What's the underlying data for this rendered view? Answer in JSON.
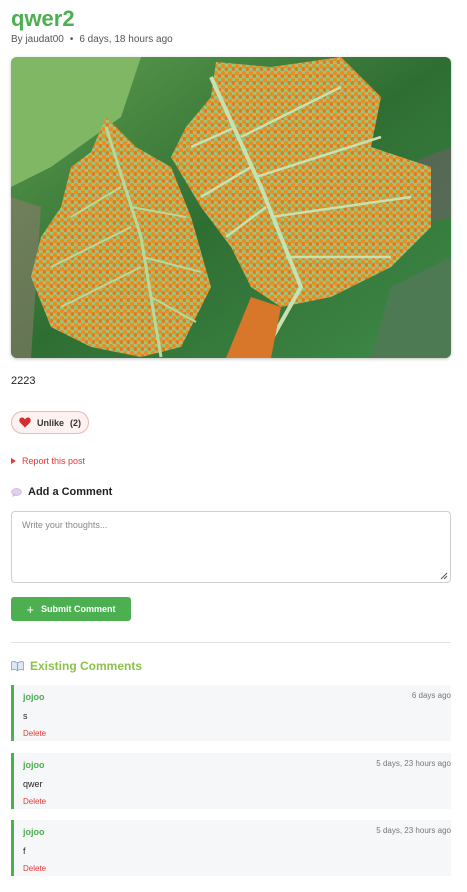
{
  "post": {
    "title": "qwer2",
    "author_line": "By jaudat00",
    "time_line": "6 days, 18 hours ago",
    "body": "2223",
    "image_alt": "leaf-with-orange-rust"
  },
  "like": {
    "label": "Unlike",
    "count": "(2)"
  },
  "report": {
    "label": "Report this post"
  },
  "add_comment": {
    "heading": "Add a Comment",
    "placeholder": "Write your thoughts...",
    "submit_label": "Submit Comment"
  },
  "existing": {
    "heading": "Existing Comments",
    "comments": [
      {
        "author": "jojoo",
        "time": "6 days ago",
        "text": "s",
        "delete_label": "Delete"
      },
      {
        "author": "jojoo",
        "time": "5 days, 23 hours ago",
        "text": "qwer",
        "delete_label": "Delete"
      },
      {
        "author": "jojoo",
        "time": "5 days, 23 hours ago",
        "text": "f",
        "delete_label": "Delete"
      }
    ]
  },
  "colors": {
    "accent": "#4caf50",
    "accent_light": "#8bc34a",
    "danger": "#e53935"
  },
  "icons": [
    "heart-icon",
    "triangle-right-icon",
    "speech-bubble-icon",
    "book-icon",
    "plus-icon",
    "resize-handle-icon"
  ]
}
